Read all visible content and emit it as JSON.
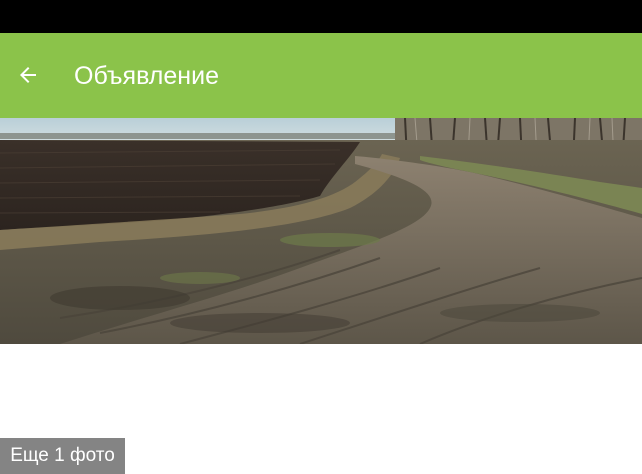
{
  "app_bar": {
    "title": "Объявление",
    "back_icon": "arrow-back-icon",
    "background_color": "#8bc34a"
  },
  "photo": {
    "icon": "field-road-photo"
  },
  "more_photos": {
    "label": "Еще 1 фото"
  }
}
